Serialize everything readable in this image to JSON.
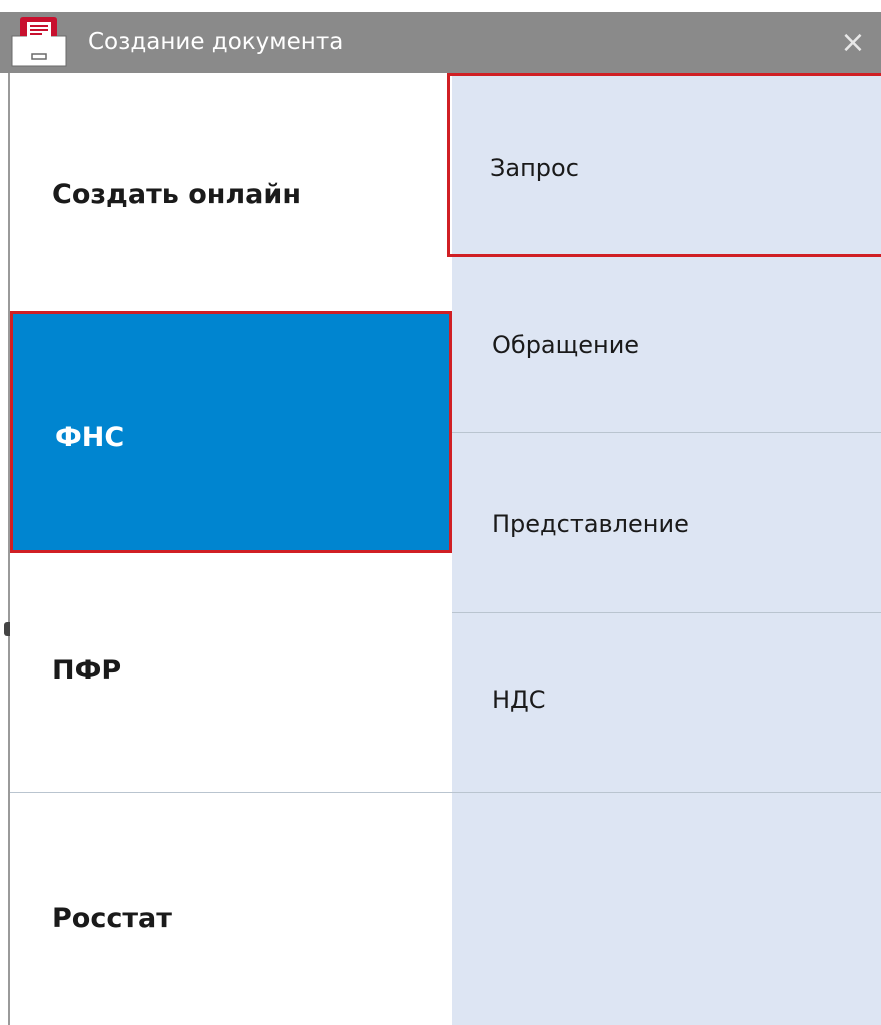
{
  "window": {
    "title": "Создание документа",
    "close_glyph": "×",
    "icon": "document-app-icon"
  },
  "categories": [
    {
      "label": "Создать онлайн",
      "selected": false
    },
    {
      "label": "ФНС",
      "selected": true
    },
    {
      "label": "ПФР",
      "selected": false
    },
    {
      "label": "Росстат",
      "selected": false
    }
  ],
  "documents": [
    {
      "label": "Запрос",
      "selected": true
    },
    {
      "label": "Обращение",
      "selected": false
    },
    {
      "label": "Представление",
      "selected": false
    },
    {
      "label": "НДС",
      "selected": false
    }
  ],
  "colors": {
    "titlebar": "#8a8a8a",
    "selected_category_bg": "#0085d0",
    "selection_border": "#d01f24",
    "documents_bg": "#dde5f3",
    "divider": "#b9c4cf"
  }
}
